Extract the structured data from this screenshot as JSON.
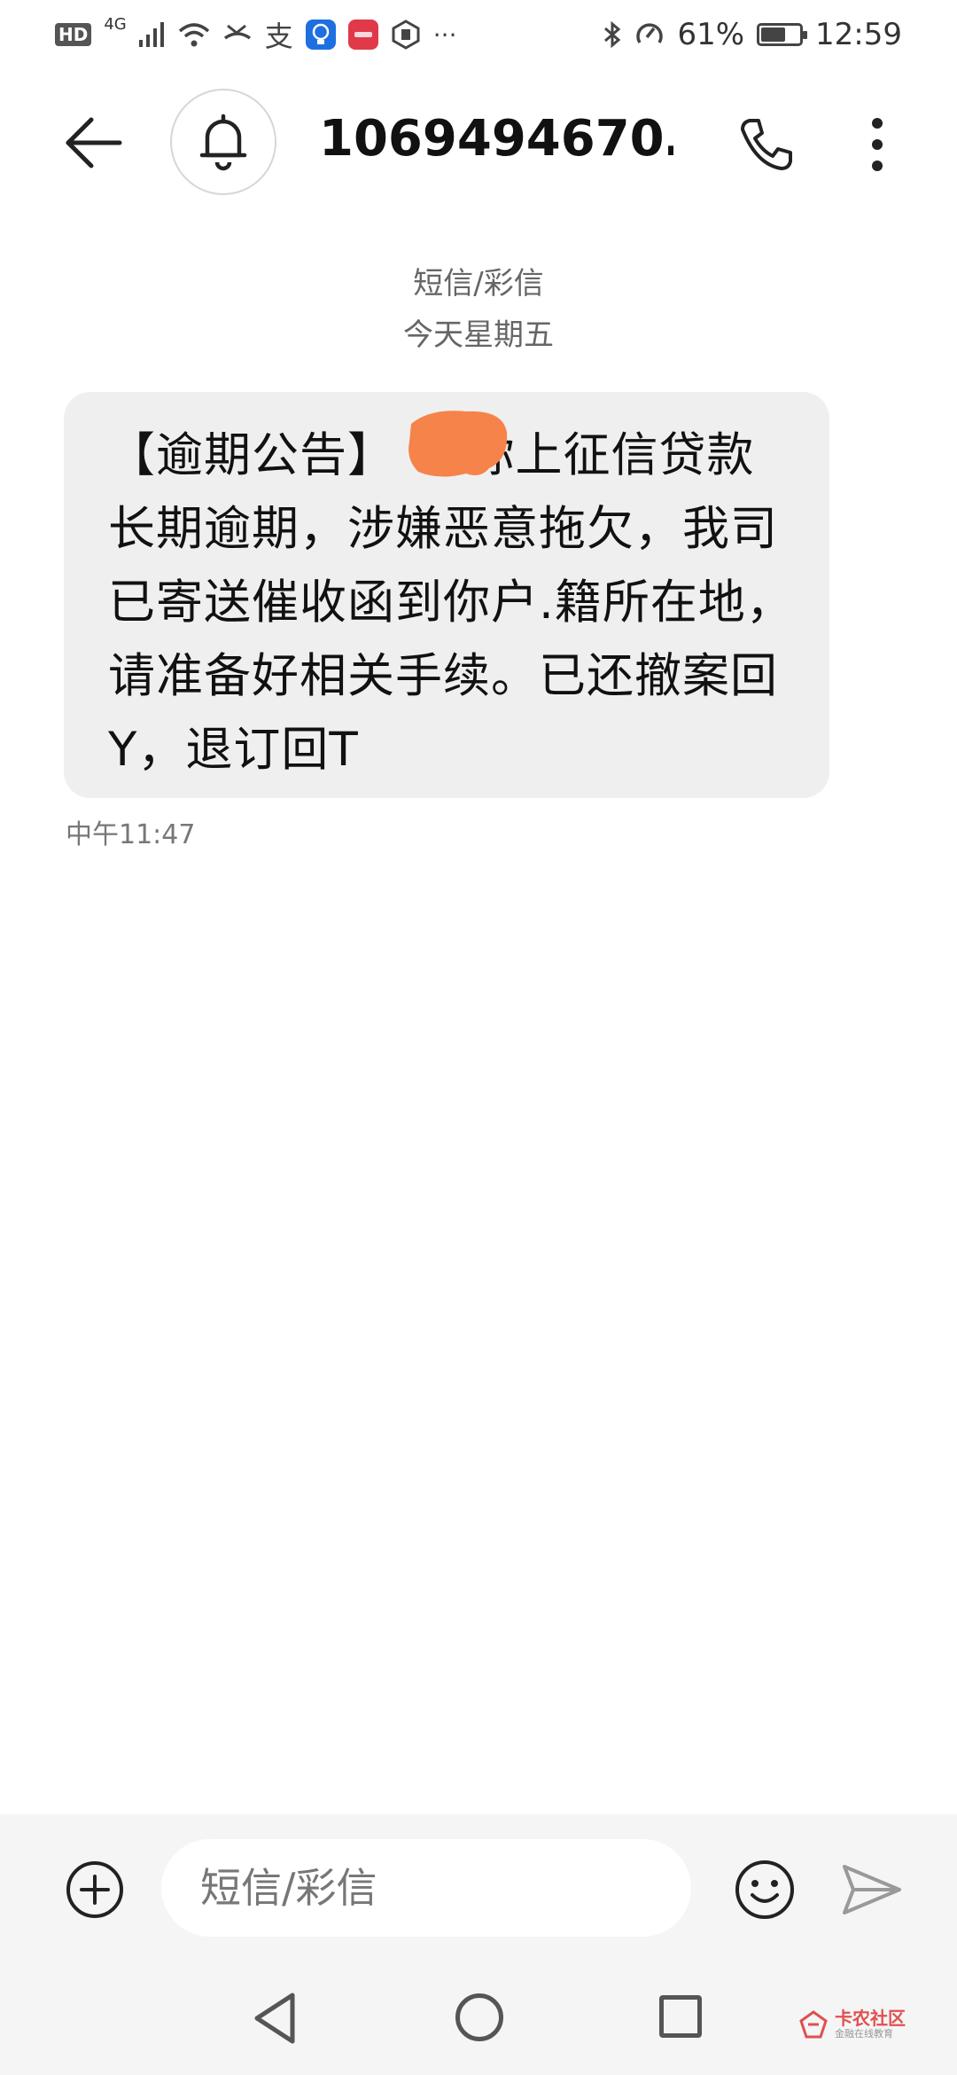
{
  "status_bar": {
    "hd_label": "HD",
    "network_label": "4G",
    "icons": [
      "signal-icon",
      "wifi-icon",
      "missed-call-icon",
      "alipay-icon",
      "lightbulb-app-icon",
      "huawei-app-icon",
      "hexagon-app-icon",
      "more-notifications-icon"
    ],
    "alipay_glyph": "支",
    "overflow_glyph": "···",
    "battery_percent_text": "61%",
    "battery_level": 0.61,
    "time": "12:59"
  },
  "header": {
    "contact_title": "1069494670…",
    "icons": [
      "back-arrow-icon",
      "bell-icon",
      "phone-icon",
      "more-vertical-icon"
    ]
  },
  "conversation": {
    "message_type_label": "短信/彩信",
    "date_label": "今天星期五",
    "messages": [
      {
        "text": "【逾期公告】　　你上征信贷款长期逾期，涉嫌恶意拖欠，我司已寄送催收函到你户.籍所在地，请准备好相关手续。已还撤案回Y，退订回T",
        "time": "中午11:47",
        "redaction_color": "#f5834a"
      }
    ]
  },
  "composer": {
    "placeholder": "短信/彩信",
    "icons": [
      "add-circle-icon",
      "emoji-icon",
      "send-icon"
    ]
  },
  "navbar": {
    "icons": [
      "nav-back-icon",
      "nav-home-icon",
      "nav-recents-icon"
    ]
  },
  "watermark": {
    "title": "卡农社区",
    "subtitle": "金融在线教育"
  },
  "colors": {
    "bubble_bg": "#efefef",
    "composer_bg": "#f5f5f5",
    "icon_dark": "#222222",
    "muted_text": "#666666"
  }
}
